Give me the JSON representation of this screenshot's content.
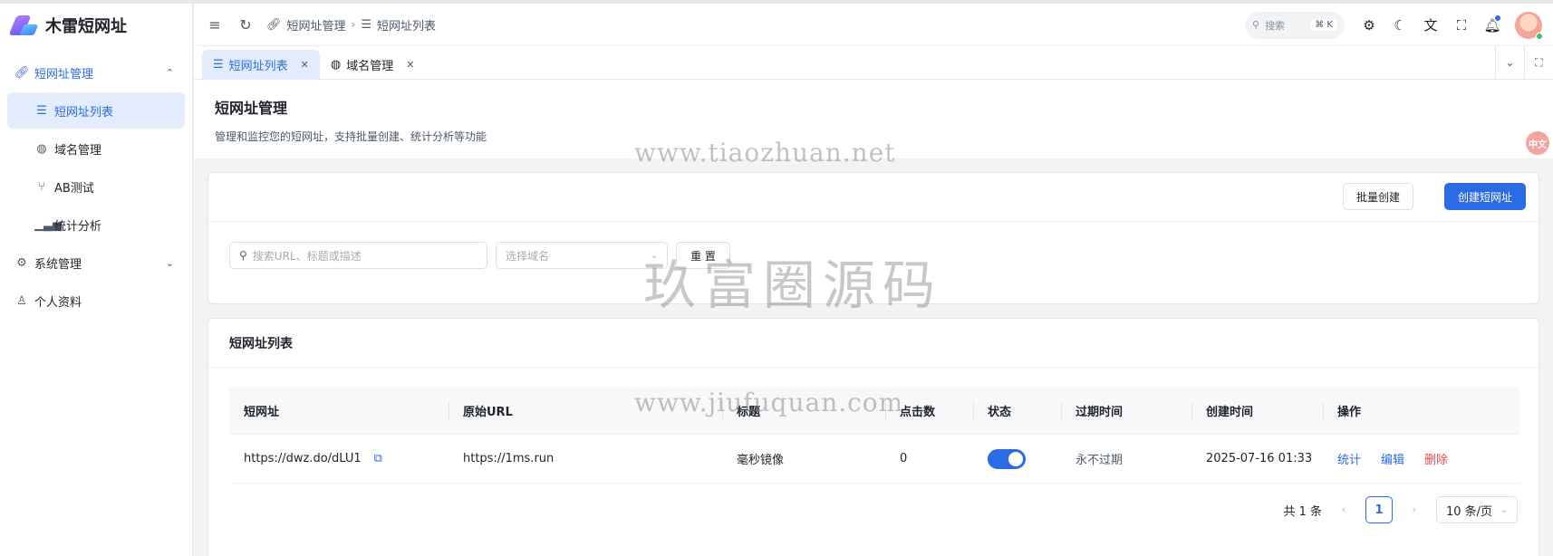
{
  "app": {
    "name": "木雷短网址"
  },
  "sidebar": {
    "items": [
      {
        "label": "短网址管理",
        "icon": "link-icon",
        "arrow": "⌃"
      },
      {
        "label": "短网址列表",
        "icon": "list-icon"
      },
      {
        "label": "域名管理",
        "icon": "globe-icon"
      },
      {
        "label": "AB测试",
        "icon": "split-icon"
      },
      {
        "label": "统计分析",
        "icon": "bar-chart-icon"
      },
      {
        "label": "系统管理",
        "icon": "gear-icon",
        "arrow": "⌄"
      },
      {
        "label": "个人资料",
        "icon": "user-icon"
      }
    ]
  },
  "header": {
    "breadcrumb": [
      "短网址管理",
      "短网址列表"
    ],
    "search_label": "搜索",
    "search_kbd": "⌘ K"
  },
  "tabs": [
    {
      "label": "短网址列表",
      "active": true
    },
    {
      "label": "域名管理",
      "active": false
    }
  ],
  "page": {
    "title": "短网址管理",
    "description": "管理和监控您的短网址，支持批量创建、统计分析等功能",
    "side_badge": "中文"
  },
  "toolbar": {
    "batch_create": "批量创建",
    "create": "创建短网址"
  },
  "filters": {
    "search_placeholder": "搜索URL、标题或描述",
    "domain_placeholder": "选择域名",
    "reset": "重 置"
  },
  "list": {
    "title": "短网址列表",
    "columns": [
      "短网址",
      "原始URL",
      "标题",
      "点击数",
      "状态",
      "过期时间",
      "创建时间",
      "操作"
    ],
    "rows": [
      {
        "short_url": "https://dwz.do/dLU1",
        "original_url": "https://1ms.run",
        "title": "毫秒镜像",
        "clicks": "0",
        "enabled": true,
        "expire": "永不过期",
        "created": "2025-07-16 01:33",
        "actions": [
          "统计",
          "编辑",
          "删除"
        ]
      }
    ]
  },
  "pagination": {
    "total": "共 1 条",
    "current": "1",
    "page_size": "10 条/页"
  },
  "watermarks": [
    "www.tiaozhuan.net",
    "玖富圈源码",
    "www.jiufuquan.com"
  ],
  "colors": {
    "primary": "#2b6be6",
    "danger": "#f04b4b",
    "active_bg": "#e3ecfc"
  }
}
